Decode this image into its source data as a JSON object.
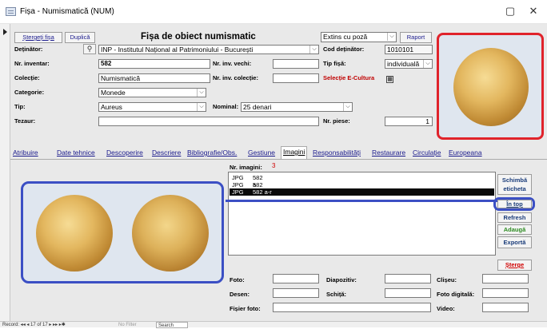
{
  "window": {
    "title": "Fișa - Numismatică (NUM)",
    "minimize_icon": "minimize-icon",
    "close_icon": "close-icon"
  },
  "header": {
    "delete_btn": "Ștergeți fișa",
    "duplicate_btn": "Duplică",
    "form_title": "Fișa de obiect numismatic",
    "view_select": "Extins cu poză",
    "report_btn": "Raport"
  },
  "fields": {
    "detinator": {
      "label": "Deținător:",
      "value": "INP - Institutul Național al Patrimoniului - București"
    },
    "cod_detinator": {
      "label": "Cod deținător:",
      "value": "1010101"
    },
    "nr_inventar": {
      "label": "Nr. inventar:",
      "value": "582"
    },
    "nr_inv_vechi": {
      "label": "Nr. inv. vechi:",
      "value": ""
    },
    "tip_fisa": {
      "label": "Tip fișă:",
      "value": "individuală"
    },
    "colectie": {
      "label": "Colecție:",
      "value": "Numismatică"
    },
    "nr_inv_colectie": {
      "label": "Nr. inv. colecție:",
      "value": ""
    },
    "selectie": {
      "label": "Selecție E-Cultura"
    },
    "categorie": {
      "label": "Categorie:",
      "value": "Monede"
    },
    "tip": {
      "label": "Tip:",
      "value": "Aureus"
    },
    "nominal": {
      "label": "Nominal:",
      "value": "25 denari"
    },
    "tezaur": {
      "label": "Tezaur:",
      "value": ""
    },
    "nr_piese": {
      "label": "Nr. piese:",
      "value": "1"
    }
  },
  "tabs": [
    {
      "label": "Atribuire"
    },
    {
      "label": "Date tehnice"
    },
    {
      "label": "Descoperire"
    },
    {
      "label": "Descriere"
    },
    {
      "label": "Bibliografie/Obs."
    },
    {
      "label": "Gestiune"
    },
    {
      "label": "Imagini",
      "active": true
    },
    {
      "label": "Responsabilități"
    },
    {
      "label": "Restaurare"
    },
    {
      "label": "Circulație"
    },
    {
      "label": "Europeana"
    }
  ],
  "images": {
    "count_label": "Nr. imagini:",
    "count_value": "3",
    "list": [
      {
        "type": "JPG",
        "name": "582 a"
      },
      {
        "type": "JPG",
        "name": "582 r"
      },
      {
        "type": "JPG",
        "name": "582 a-r",
        "selected": true
      }
    ],
    "buttons": {
      "change_label": "Schimbă eticheta",
      "on_top": "În top",
      "refresh": "Refresh",
      "add": "Adaugă",
      "export": "Exportă",
      "delete": "Șterge"
    },
    "button_colors": {
      "add": "#2e8b22",
      "delete": "#d00000",
      "highlight": "#3b4fc4",
      "photo_frame": "#e0232b"
    }
  },
  "bottom": {
    "foto": "Foto:",
    "diapozitiv": "Diapozitiv:",
    "clisteu": "Clișeu:",
    "desen": "Desen:",
    "schita": "Schiță:",
    "foto_digitala": "Foto digitală:",
    "fisier_foto": "Fișier foto:",
    "video": "Video:"
  },
  "statusbar": {
    "record": "Record: ◂◂  ◂  17 of 17  ▸  ▸▸  ▸✱",
    "filter": "No Filter",
    "search": "Search"
  }
}
